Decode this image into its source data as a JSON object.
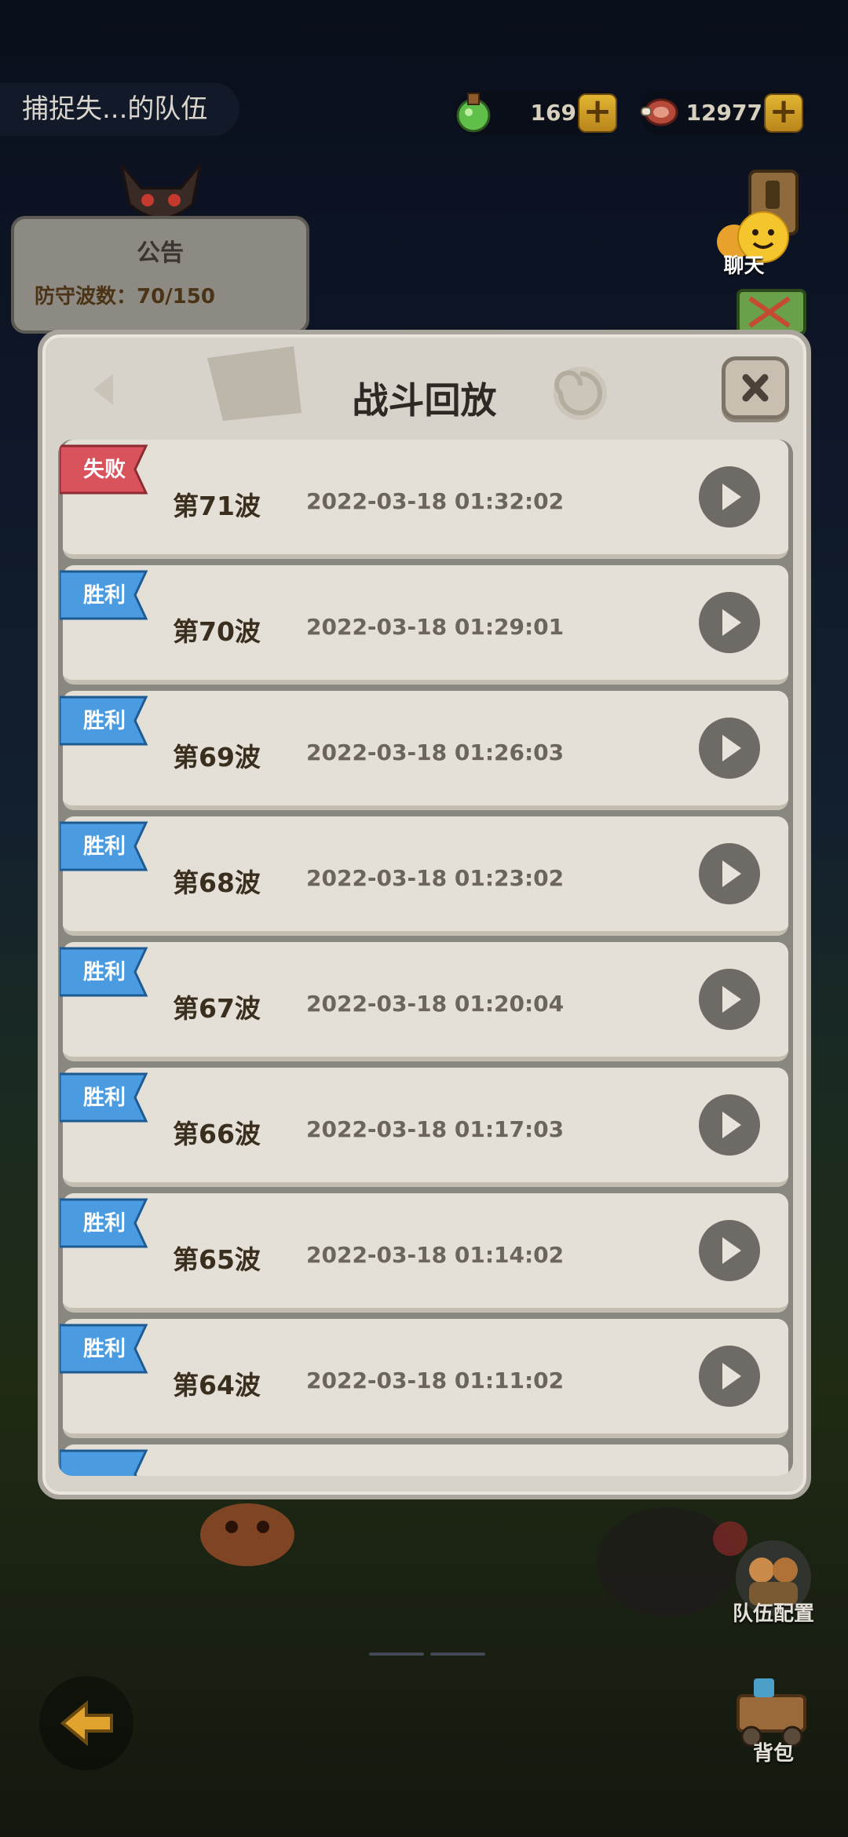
{
  "top_bar": {
    "team_name": "捕捉失...的队伍",
    "potion_count": "169",
    "meat_count": "12977",
    "plus_symbol": "+"
  },
  "board": {
    "title": "公告",
    "defense_waves": "防守波数：70/150"
  },
  "side": {
    "chat_label": "聊天",
    "team_config_label": "队伍配置",
    "bag_label": "背包"
  },
  "modal": {
    "title": "战斗回放",
    "close_symbol": "✕",
    "rows": [
      {
        "result": "失败",
        "wave": "第71波",
        "time": "2022-03-18 01:32:02"
      },
      {
        "result": "胜利",
        "wave": "第70波",
        "time": "2022-03-18 01:29:01"
      },
      {
        "result": "胜利",
        "wave": "第69波",
        "time": "2022-03-18 01:26:03"
      },
      {
        "result": "胜利",
        "wave": "第68波",
        "time": "2022-03-18 01:23:02"
      },
      {
        "result": "胜利",
        "wave": "第67波",
        "time": "2022-03-18 01:20:04"
      },
      {
        "result": "胜利",
        "wave": "第66波",
        "time": "2022-03-18 01:17:03"
      },
      {
        "result": "胜利",
        "wave": "第65波",
        "time": "2022-03-18 01:14:02"
      },
      {
        "result": "胜利",
        "wave": "第64波",
        "time": "2022-03-18 01:11:02"
      }
    ]
  },
  "colors": {
    "defeat_ribbon": "#d9535c",
    "victory_ribbon": "#4a9be0",
    "accent_plus": "#e2b531"
  },
  "icons": {
    "potion": "potion-icon",
    "meat": "meat-icon",
    "play": "play-icon",
    "close": "close-icon",
    "back": "back-arrow-icon"
  }
}
